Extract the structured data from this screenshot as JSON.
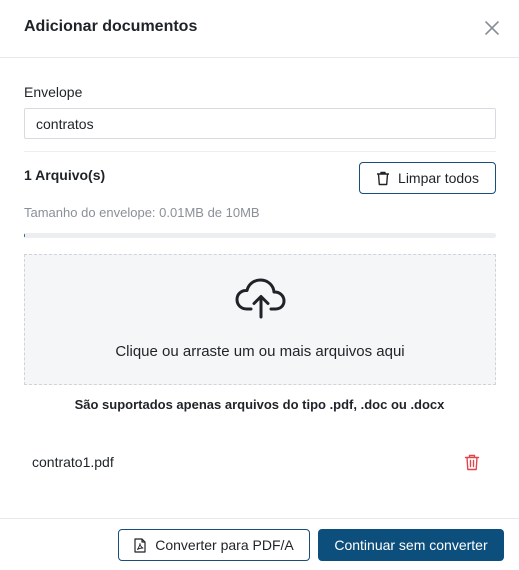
{
  "header": {
    "title": "Adicionar documentos",
    "close_icon": "close-icon"
  },
  "envelope": {
    "label": "Envelope",
    "value": "contratos"
  },
  "files": {
    "count_label": "1 Arquivo(s)",
    "clear_all_label": "Limpar todos",
    "clear_icon": "trash-icon",
    "size_text": "Tamanho do envelope: 0.01MB de 10MB",
    "size_used_mb": 0.01,
    "size_limit_mb": 10
  },
  "dropzone": {
    "icon": "cloud-upload-icon",
    "text": "Clique ou arraste um ou mais arquivos aqui"
  },
  "supported_text": "São suportados apenas arquivos do tipo .pdf, .doc ou .docx",
  "file_list": [
    {
      "name": "contrato1.pdf",
      "delete_icon": "trash-icon"
    }
  ],
  "footer": {
    "convert_label": "Converter para PDF/A",
    "convert_icon": "pdf-file-icon",
    "continue_label": "Continuar sem converter"
  },
  "colors": {
    "primary": "#0d4f7c",
    "delete": "#e0454e",
    "dropzone_bg": "#f5f6f7"
  }
}
